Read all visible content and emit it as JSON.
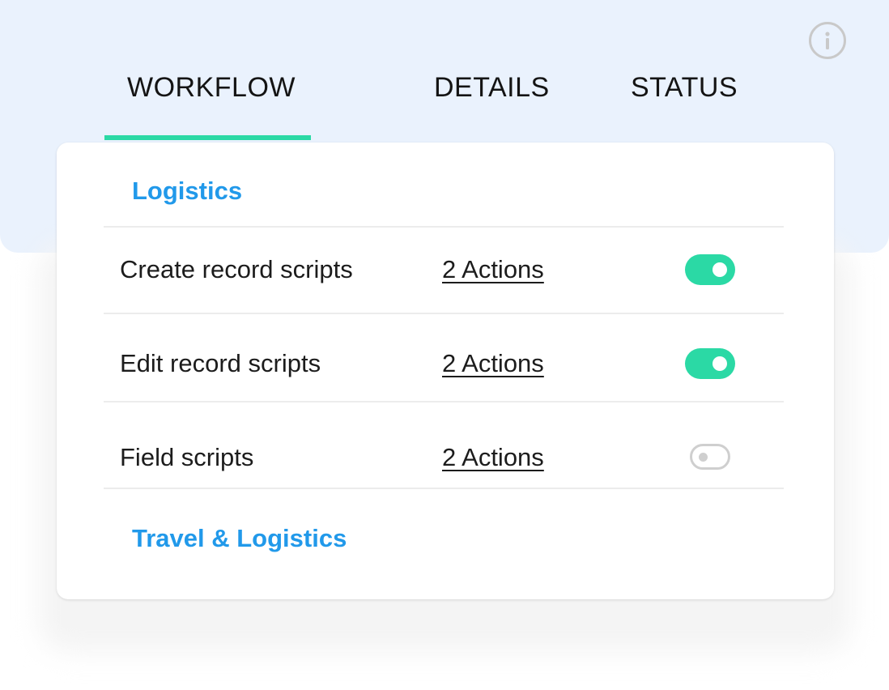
{
  "tabs": [
    {
      "label": "WORKFLOW",
      "active": true
    },
    {
      "label": "DETAILS",
      "active": false
    },
    {
      "label": "STATUS",
      "active": false
    }
  ],
  "info_icon": "info-icon",
  "colors": {
    "header_background": "#eaf2fd",
    "accent_green": "#2bd9a5",
    "group_title_blue": "#2199ea",
    "toggle_off_gray": "#cfcfcf"
  },
  "groups": [
    {
      "title": "Logistics",
      "rows": [
        {
          "label": "Create record scripts",
          "actions": "2 Actions",
          "enabled": true
        },
        {
          "label": "Edit record scripts",
          "actions": "2 Actions",
          "enabled": true
        },
        {
          "label": "Field scripts",
          "actions": "2 Actions",
          "enabled": false
        }
      ]
    },
    {
      "title": "Travel & Logistics",
      "rows": []
    }
  ]
}
